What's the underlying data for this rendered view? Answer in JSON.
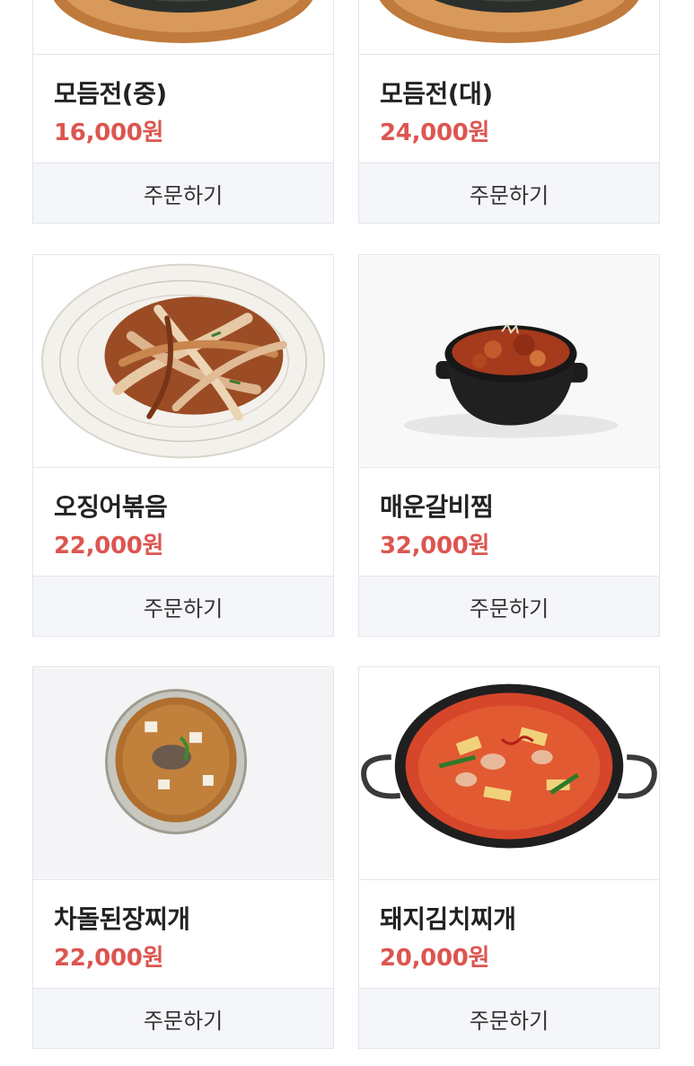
{
  "products": [
    {
      "name": "모듬전(중)",
      "price": "16,000원",
      "order_label": "주문하기",
      "image": "mixed-jeon-plate"
    },
    {
      "name": "모듬전(대)",
      "price": "24,000원",
      "order_label": "주문하기",
      "image": "mixed-jeon-plate"
    },
    {
      "name": "오징어볶음",
      "price": "22,000원",
      "order_label": "주문하기",
      "image": "stir-fried-squid"
    },
    {
      "name": "매운갈비찜",
      "price": "32,000원",
      "order_label": "주문하기",
      "image": "spicy-braised-ribs"
    },
    {
      "name": "차돌된장찌개",
      "price": "22,000원",
      "order_label": "주문하기",
      "image": "brisket-doenjang-stew"
    },
    {
      "name": "돼지김치찌개",
      "price": "20,000원",
      "order_label": "주문하기",
      "image": "pork-kimchi-stew"
    }
  ]
}
